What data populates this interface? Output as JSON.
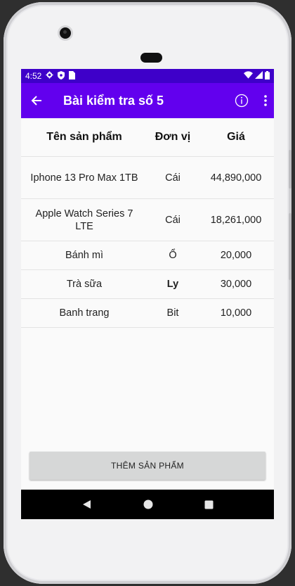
{
  "status_bar": {
    "time": "4:52"
  },
  "app_bar": {
    "title": "Bài kiểm tra số 5"
  },
  "table": {
    "headers": [
      "Tên sản phẩm",
      "Đơn vị",
      "Giá"
    ],
    "rows": [
      {
        "name": "Iphone 13 Pro Max 1TB",
        "unit": "Cái",
        "price": "44,890,000"
      },
      {
        "name": "Apple Watch Series 7 LTE",
        "unit": "Cái",
        "price": "18,261,000"
      },
      {
        "name": "Bánh mì",
        "unit": "Ổ",
        "price": "20,000"
      },
      {
        "name": "Trà sữa",
        "unit": "Ly",
        "price": "30,000"
      },
      {
        "name": "Banh trang",
        "unit": "Bit",
        "price": "10,000"
      }
    ]
  },
  "add_button": {
    "label": "THÊM SẢN PHẨM"
  },
  "colors": {
    "status_bar": "#3e00c9",
    "app_bar": "#6200ee",
    "button": "#d6d7d7"
  }
}
